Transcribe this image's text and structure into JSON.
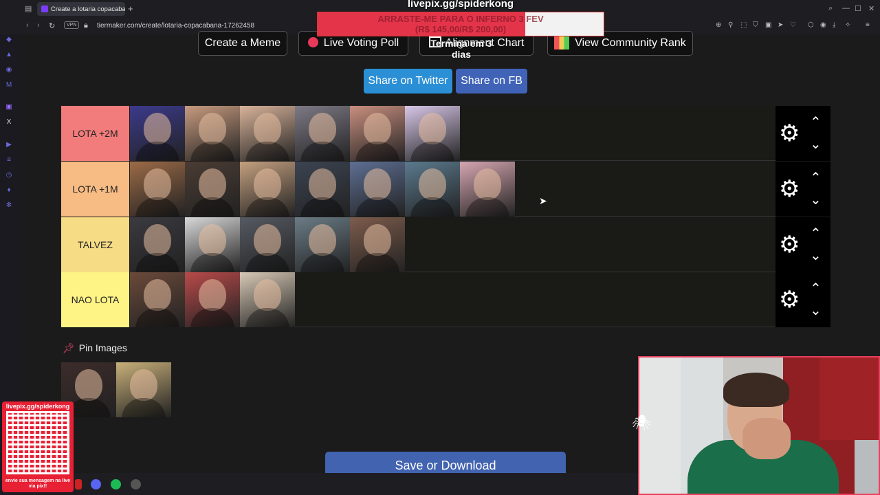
{
  "browser": {
    "tab_title": "Create a lotaria copacabana",
    "tab_plus": "+",
    "vpn": "VPN",
    "url": "tiermaker.com/create/lotaria-copacabana-17262458"
  },
  "overlay": {
    "title": "livepix.gg/spiderkong",
    "goal_line1": "ARRASTE-ME PARA O INFERNO 3 FEV",
    "goal_line2": "(R$ 145,00/R$ 200,00)",
    "goal_progress": 0.725,
    "countdown": "Termina em 3 dias",
    "qr_top": "livepix.gg/spiderkong",
    "qr_bottom": "envie sua mensagem na live via pix!!"
  },
  "actions": {
    "create_meme": "Create a Meme",
    "live_voting": "Live Voting Poll",
    "alignment": "Alignment Chart",
    "community_rank": "View Community Rank",
    "share_twitter": "Share on Twitter",
    "share_fb": "Share on FB",
    "save": "Save or Download"
  },
  "tiers": [
    {
      "label": "LOTA +2M",
      "color": "#f27c7c",
      "items": [
        "#3b3a8c",
        "#c79b7f",
        "#d8b39a",
        "#7e7a86",
        "#c98f7f",
        "#d8c7e8"
      ]
    },
    {
      "label": "LOTA +1M",
      "color": "#f7bc84",
      "items": [
        "#9c6b47",
        "#4a3c34",
        "#c4a07f",
        "#3c4452",
        "#5e6f93",
        "#5b7a8e",
        "#d6a6b2"
      ]
    },
    {
      "label": "TALVEZ",
      "color": "#f7dc86",
      "items": [
        "#3a3a40",
        "#d8d8d8",
        "#565a62",
        "#6b7c86",
        "#7d5c4c"
      ]
    },
    {
      "label": "NAO LOTA",
      "color": "#fef385",
      "items": [
        "#6b4a3a",
        "#b94a4a",
        "#d7c9b6"
      ]
    }
  ],
  "pin": {
    "title": "Pin Images",
    "items": [
      "#3c2c2a",
      "#c8b07a"
    ]
  },
  "icons": {
    "gear": "gear-icon",
    "up": "chevron-up-icon",
    "down": "chevron-down-icon",
    "pin": "pin-icon"
  }
}
